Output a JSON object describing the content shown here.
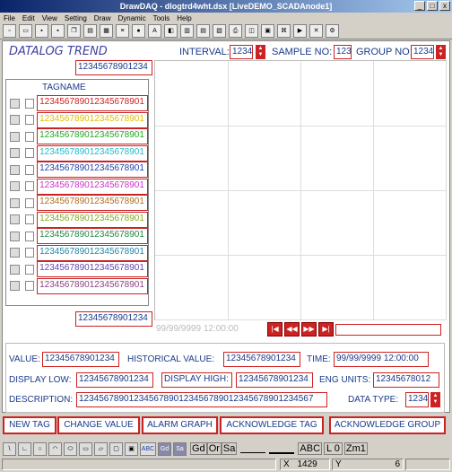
{
  "window": {
    "title": "DrawDAQ - dlogtrd4wht.dsx [LiveDEMO_SCADAnode1]",
    "ctrl_min": "_",
    "ctrl_max": "□",
    "ctrl_close": "x"
  },
  "menu": [
    "File",
    "Edit",
    "View",
    "Setting",
    "Draw",
    "Dynamic",
    "Tools",
    "Help"
  ],
  "header": {
    "title": "DATALOG TREND",
    "interval_label": "INTERVAL:",
    "interval_value": "1234",
    "sample_label": "SAMPLE NO:",
    "sample_value": "123",
    "group_label": "GROUP NO:",
    "group_value": "1234",
    "top_value": "12345678901234",
    "bottom_value": "12345678901234"
  },
  "tag_table": {
    "header": "TAGNAME",
    "rows": [
      {
        "name": "123456789012345678901",
        "color": "#cc2222"
      },
      {
        "name": "123456789012345678901",
        "color": "#e0c000"
      },
      {
        "name": "123456789012345678901",
        "color": "#22aa22"
      },
      {
        "name": "123456789012345678901",
        "color": "#22bbcc"
      },
      {
        "name": "123456789012345678901",
        "color": "#2244aa"
      },
      {
        "name": "123456789012345678901",
        "color": "#cc33cc"
      },
      {
        "name": "123456789012345678901",
        "color": "#b07020"
      },
      {
        "name": "123456789012345678901",
        "color": "#88aa22"
      },
      {
        "name": "123456789012345678901",
        "color": "#228844"
      },
      {
        "name": "123456789012345678901",
        "color": "#2288aa"
      },
      {
        "name": "123456789012345678901",
        "color": "#6644aa"
      },
      {
        "name": "123456789012345678901",
        "color": "#884488"
      }
    ]
  },
  "nav": {
    "timestamp": "99/99/9999 12:00:00",
    "first": "|◀",
    "prev": "◀◀",
    "next": "▶▶",
    "last": "▶|"
  },
  "details": {
    "value_label": "VALUE:",
    "value": "12345678901234",
    "hist_label": "HISTORICAL VALUE:",
    "hist_value": "12345678901234",
    "time_label": "TIME:",
    "time_value": "99/99/9999 12:00:00",
    "low_label": "DISPLAY LOW:",
    "low_value": "12345678901234",
    "high_label": "DISPLAY HIGH:",
    "high_value": "12345678901234",
    "units_label": "ENG UNITS:",
    "units_value": "12345678012",
    "desc_label": "DESCRIPTION:",
    "desc_value": "12345678901234567890123456789012345678901234567",
    "dtype_label": "DATA TYPE:",
    "dtype_value": "1234"
  },
  "commands": [
    "NEW TAG",
    "CHANGE VALUE",
    "ALARM GRAPH",
    "ACKNOWLEDGE TAG",
    "ACKNOWLEDGE GROUP"
  ],
  "drawtools": [
    "\\",
    "∟",
    "○",
    "◠",
    "⬭",
    "▭",
    "▱",
    "▢",
    "▣",
    "ABC",
    "Gd",
    "Sa"
  ],
  "drawtext": {
    "gd": "Gd",
    "or": "Or",
    "sa": "Sa",
    "abc": "ABC",
    "layer": "L 0",
    "zoom": "Zm1"
  },
  "status": {
    "x_label": "X",
    "x_value": "1429",
    "y_label": "Y",
    "y_value": "6"
  }
}
